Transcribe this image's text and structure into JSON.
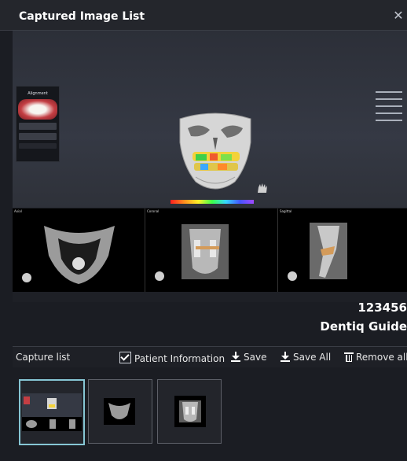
{
  "window": {
    "title": "Captured Image List",
    "close_glyph": "✕"
  },
  "preview": {
    "alignment_panel_title": "Alignment",
    "ct_views": [
      "Axial",
      "Coronal",
      "Sagittal"
    ]
  },
  "patient": {
    "id": "123456",
    "product": "Dentiq Guide"
  },
  "capture_bar": {
    "label": "Capture list",
    "patient_info_label": "Patient Information",
    "patient_info_checked": true,
    "save_label": "Save",
    "save_all_label": "Save All",
    "remove_all_label": "Remove all"
  },
  "thumbnails": [
    {
      "name": "capture-1",
      "selected": true
    },
    {
      "name": "capture-2",
      "selected": false
    },
    {
      "name": "capture-3",
      "selected": false
    }
  ],
  "colors": {
    "accent_selected": "#86c6d4",
    "background": "#1b1d23"
  }
}
